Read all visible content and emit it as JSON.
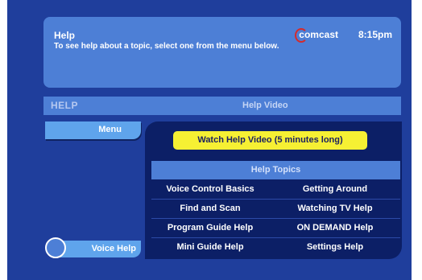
{
  "info": {
    "title": "Help",
    "text": "To see help about a topic, select one from the menu below.",
    "brand": "comcast",
    "time": "8:15pm"
  },
  "header": {
    "section": "HELP",
    "page": "Help Video"
  },
  "menu_label": "Menu",
  "watch_label": "Watch Help Video (5 minutes long)",
  "topics_header": "Help Topics",
  "topics": [
    {
      "left": "Voice Control Basics",
      "right": "Getting Around"
    },
    {
      "left": "Find and Scan",
      "right": "Watching TV Help"
    },
    {
      "left": "Program Guide Help",
      "right": "ON DEMAND Help"
    },
    {
      "left": "Mini Guide Help",
      "right": "Settings Help"
    }
  ],
  "voice_help_label": "Voice Help",
  "colors": {
    "background": "#1f3e9c",
    "panel": "#4d7fd6",
    "button": "#5fa4ec",
    "highlight": "#f6f033",
    "brand_accent": "#d62a2a"
  }
}
